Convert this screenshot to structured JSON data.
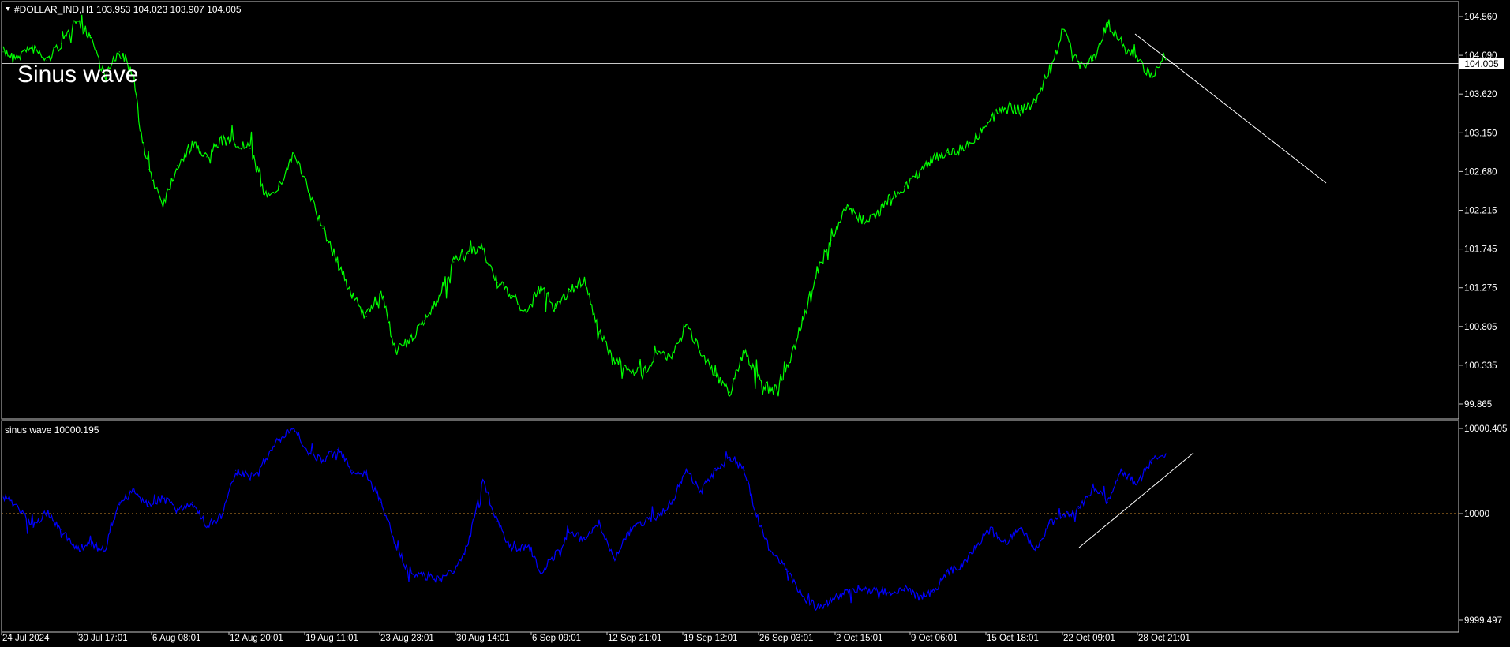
{
  "symbol_header": "#DOLLAR_IND,H1  103.953 104.023 103.907 104.005",
  "overlay_label": "Sinus wave",
  "indicator_header": "sinus wave 10000.195",
  "colors": {
    "background": "#000000",
    "price_line": "#00ff00",
    "indicator_line": "#0000ff",
    "zero_line": "#d08a2a",
    "border": "#c8c8c8",
    "trendline": "#ffffff"
  },
  "price_axis_labels": [
    "104.560",
    "104.090",
    "103.620",
    "103.150",
    "102.680",
    "102.215",
    "101.745",
    "101.275",
    "100.805",
    "100.335",
    "99.865"
  ],
  "current_price_label": "104.005",
  "indicator_axis_labels": [
    "10000.405",
    "10000",
    "9999.497"
  ],
  "time_axis_labels": [
    "24 Jul 2024",
    "30 Jul 17:01",
    "6 Aug 08:01",
    "12 Aug 20:01",
    "19 Aug 11:01",
    "23 Aug 23:01",
    "30 Aug 14:01",
    "6 Sep 09:01",
    "12 Sep 21:01",
    "19 Sep 12:01",
    "26 Sep 03:01",
    "2 Oct 15:01",
    "9 Oct 06:01",
    "15 Oct 18:01",
    "22 Oct 09:01",
    "28 Oct 21:01"
  ],
  "chart_data": [
    {
      "type": "line",
      "title": "#DOLLAR_IND,H1",
      "ylim": [
        99.75,
        104.68
      ],
      "current_price": 104.005,
      "series": [
        {
          "name": "#DOLLAR_IND",
          "x": [
            0,
            2,
            4,
            6,
            8,
            10,
            12,
            14,
            16,
            18,
            19,
            20,
            22,
            24,
            26,
            28,
            30,
            32,
            34,
            36,
            38,
            40,
            42,
            44,
            46,
            48,
            50,
            52,
            54,
            56,
            58,
            60,
            62,
            64,
            66,
            68,
            70,
            72,
            74,
            76,
            78,
            80,
            82,
            84,
            86,
            88,
            90,
            92,
            94,
            96,
            98,
            100,
            102,
            104,
            106,
            108,
            110,
            112,
            114,
            116,
            118,
            120,
            122,
            124,
            126,
            128,
            130,
            132,
            134,
            136,
            138,
            140,
            142,
            144,
            146,
            148,
            150,
            152,
            154,
            156,
            158,
            160
          ],
          "values": [
            104.1,
            104.05,
            104.15,
            104.0,
            104.2,
            104.45,
            104.3,
            103.8,
            104.1,
            103.8,
            103.1,
            102.7,
            102.3,
            102.75,
            103.0,
            102.85,
            103.05,
            103.0,
            102.95,
            102.4,
            102.5,
            102.9,
            102.45,
            102.0,
            101.6,
            101.2,
            100.95,
            101.25,
            100.55,
            100.65,
            100.9,
            101.2,
            101.6,
            101.7,
            101.75,
            101.35,
            101.2,
            101.0,
            101.3,
            101.05,
            101.25,
            101.4,
            100.75,
            100.45,
            100.35,
            100.25,
            100.55,
            100.45,
            100.85,
            100.55,
            100.25,
            100.05,
            100.55,
            100.2,
            100.05,
            100.35,
            100.9,
            101.5,
            101.85,
            102.25,
            102.1,
            102.15,
            102.35,
            102.5,
            102.65,
            102.85,
            102.9,
            102.95,
            103.1,
            103.3,
            103.45,
            103.4,
            103.5,
            103.9,
            104.35,
            103.95,
            104.0,
            104.45,
            104.15,
            104.05,
            103.8,
            104.005
          ]
        }
      ]
    },
    {
      "type": "line",
      "title": "sinus wave",
      "ylim": [
        9999.44,
        10000.43
      ],
      "series": [
        {
          "name": "sinus wave",
          "x": [
            0,
            2,
            4,
            6,
            8,
            10,
            12,
            14,
            16,
            18,
            20,
            22,
            24,
            26,
            28,
            30,
            32,
            34,
            36,
            38,
            40,
            42,
            44,
            46,
            48,
            50,
            52,
            54,
            56,
            58,
            60,
            62,
            64,
            66,
            68,
            70,
            72,
            74,
            76,
            78,
            80,
            82,
            84,
            86,
            88,
            90,
            92,
            94,
            96,
            98,
            100,
            102,
            104,
            106,
            108,
            110,
            112,
            114,
            116,
            118,
            120,
            122,
            124,
            126,
            128,
            130,
            132,
            134,
            136,
            138,
            140,
            142,
            144,
            146,
            148,
            150,
            152,
            154,
            156,
            158,
            160
          ],
          "values": [
            10000.08,
            10000.03,
            9999.93,
            10000.0,
            9999.92,
            9999.83,
            9999.85,
            9999.82,
            10000.05,
            10000.1,
            10000.03,
            10000.07,
            10000.01,
            10000.05,
            9999.94,
            9999.98,
            10000.2,
            10000.17,
            10000.25,
            10000.35,
            10000.4,
            10000.28,
            10000.25,
            10000.3,
            10000.2,
            10000.18,
            10000.05,
            9999.85,
            9999.7,
            9999.7,
            9999.68,
            9999.72,
            9999.85,
            10000.15,
            9999.96,
            9999.82,
            9999.85,
            9999.72,
            9999.8,
            9999.9,
            9999.88,
            9999.95,
            9999.78,
            9999.9,
            9999.95,
            9999.98,
            10000.05,
            10000.2,
            10000.1,
            10000.2,
            10000.25,
            10000.2,
            9999.95,
            9999.8,
            9999.72,
            9999.6,
            9999.55,
            9999.58,
            9999.63,
            9999.64,
            9999.63,
            9999.62,
            9999.64,
            9999.6,
            9999.62,
            9999.72,
            9999.75,
            9999.85,
            9999.92,
            9999.85,
            9999.93,
            9999.82,
            9999.95,
            9999.98,
            10000.02,
            10000.12,
            10000.05,
            10000.2,
            10000.13,
            10000.25,
            10000.28
          ]
        }
      ]
    }
  ]
}
